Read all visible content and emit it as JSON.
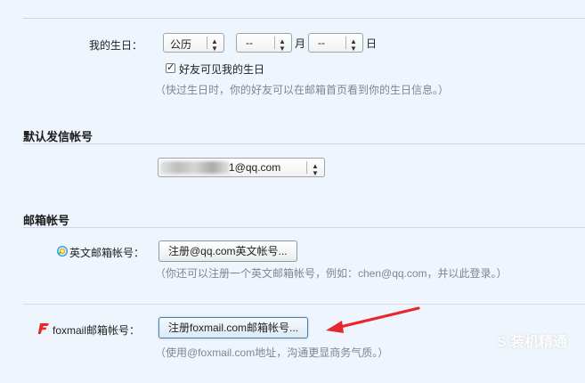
{
  "birthday": {
    "label": "我的生日：",
    "calendar_value": "公历",
    "month_value": "--",
    "month_unit": "月",
    "day_value": "--",
    "day_unit": "日",
    "visible_label": "好友可见我的生日",
    "visible_checked": true,
    "hint": "（快过生日时，你的好友可以在邮箱首页看到你的生日信息。）"
  },
  "default_sender": {
    "title": "默认发信帐号",
    "value": "1@qq.com"
  },
  "mail_accounts": {
    "title": "邮箱帐号",
    "english": {
      "label": "英文邮箱帐号：",
      "button": "注册@qq.com英文帐号...",
      "hint": "（你还可以注册一个英文邮箱帐号，例如：chen@qq.com，并以此登录。）"
    },
    "foxmail": {
      "label": "foxmail邮箱帐号：",
      "button": "注册foxmail.com邮箱帐号...",
      "hint": "（使用@foxmail.com地址，沟通更显商务气质。）"
    }
  },
  "icons": {
    "select_arrows": "up-down-arrows-icon",
    "english_mail": "qq-logo-icon",
    "foxmail": "foxmail-logo-icon",
    "annotation": "red-arrow-icon"
  },
  "colors": {
    "background": "#eef5fd",
    "hint_text": "#7d8793",
    "annotation_red": "#e8262d"
  },
  "watermark": "S 装机精通"
}
